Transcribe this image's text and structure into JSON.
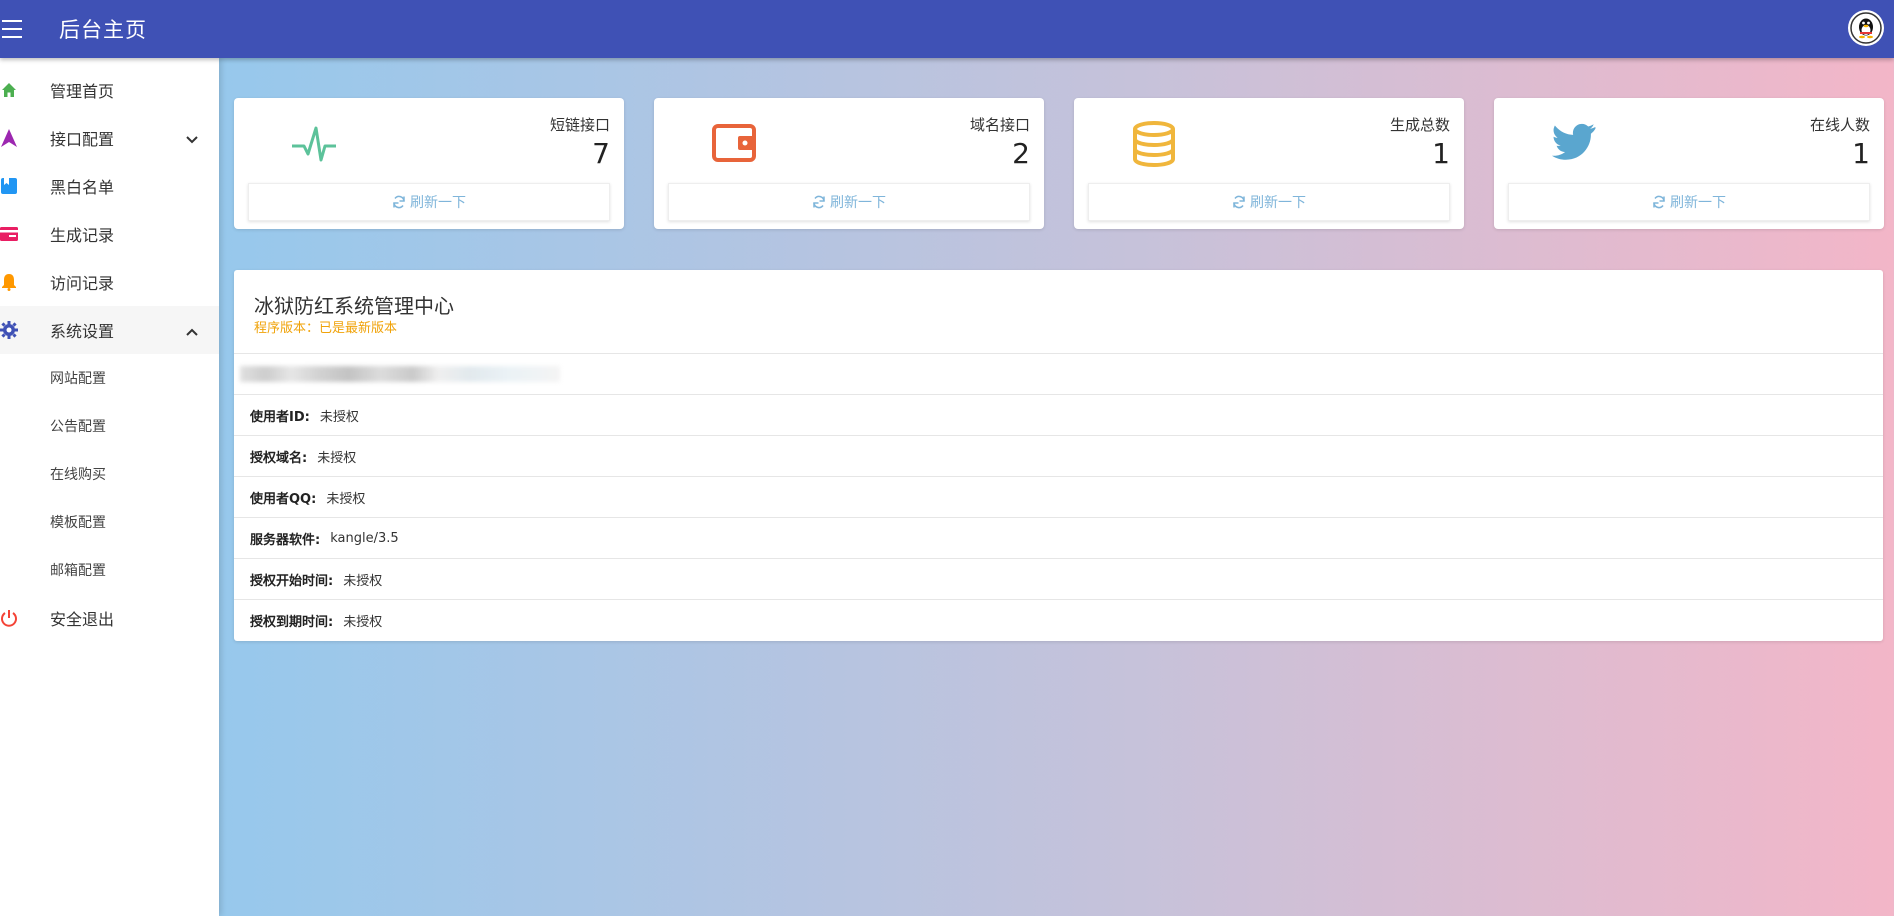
{
  "header": {
    "title": "后台主页"
  },
  "sidebar": {
    "items": [
      {
        "label": "管理首页",
        "icon": "home-icon",
        "color": "#4caf50"
      },
      {
        "label": "接口配置",
        "icon": "navigation-icon",
        "color": "#9c27b0"
      },
      {
        "label": "黑白名单",
        "icon": "bookmark-icon",
        "color": "#2196f3"
      },
      {
        "label": "生成记录",
        "icon": "card-icon",
        "color": "#e91e63"
      },
      {
        "label": "访问记录",
        "icon": "bell-icon",
        "color": "#ff9800"
      },
      {
        "label": "系统设置",
        "icon": "gear-icon",
        "color": "#3f51b5"
      }
    ],
    "sub_items": [
      "网站配置",
      "公告配置",
      "在线购买",
      "模板配置",
      "邮箱配置"
    ],
    "logout": {
      "label": "安全退出",
      "icon": "power-icon",
      "color": "#f44336"
    }
  },
  "cards": [
    {
      "label": "短链接口",
      "value": "7",
      "icon": "pulse-icon",
      "color": "#5cc29a",
      "refresh": "刷新一下"
    },
    {
      "label": "域名接口",
      "value": "2",
      "icon": "wallet-icon",
      "color": "#e8643a",
      "refresh": "刷新一下"
    },
    {
      "label": "生成总数",
      "value": "1",
      "icon": "database-icon",
      "color": "#f0b63c",
      "refresh": "刷新一下"
    },
    {
      "label": "在线人数",
      "value": "1",
      "icon": "twitter-icon",
      "color": "#5aa6cf",
      "refresh": "刷新一下"
    }
  ],
  "panel": {
    "title": "冰狱防红系统管理中心",
    "subtitle": "程序版本：已是最新版本",
    "rows": [
      {
        "key": "使用者ID:",
        "value": "未授权"
      },
      {
        "key": "授权域名:",
        "value": "未授权"
      },
      {
        "key": "使用者QQ:",
        "value": "未授权"
      },
      {
        "key": "服务器软件:",
        "value": "kangle/3.5"
      },
      {
        "key": "授权开始时间:",
        "value": "未授权"
      },
      {
        "key": "授权到期时间:",
        "value": "未授权"
      }
    ]
  }
}
